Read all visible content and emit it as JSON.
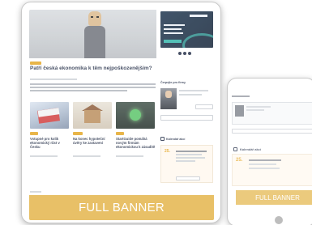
{
  "main_device": {
    "article": {
      "title": "Patří česká ekonomika k těm nejpoškozenějším?"
    },
    "cards": [
      {
        "title": "Vstupné pro kolik ekonomický růst v Česku"
      },
      {
        "title": "Na konec hypoteční úvěry ke zastavení"
      },
      {
        "title": "StartGuide pomáhá novým firmám ekonomickou k zásaditě"
      }
    ],
    "sidebar": {
      "experts_heading": "Čerpejte pro firmy",
      "calendar_heading": "Kalendář akcí",
      "event_day": "25."
    },
    "banner_label": "FULL BANNER"
  },
  "tablet_device": {
    "calendar_heading": "Kalendář akcí",
    "event_day": "25.",
    "banner_label": "FULL BANNER"
  },
  "colors": {
    "accent": "#e3a521",
    "banner": "#e3b346",
    "title": "#1f2a44",
    "ad_dark": "#17304a",
    "ad_teal": "#2fb3a8"
  }
}
